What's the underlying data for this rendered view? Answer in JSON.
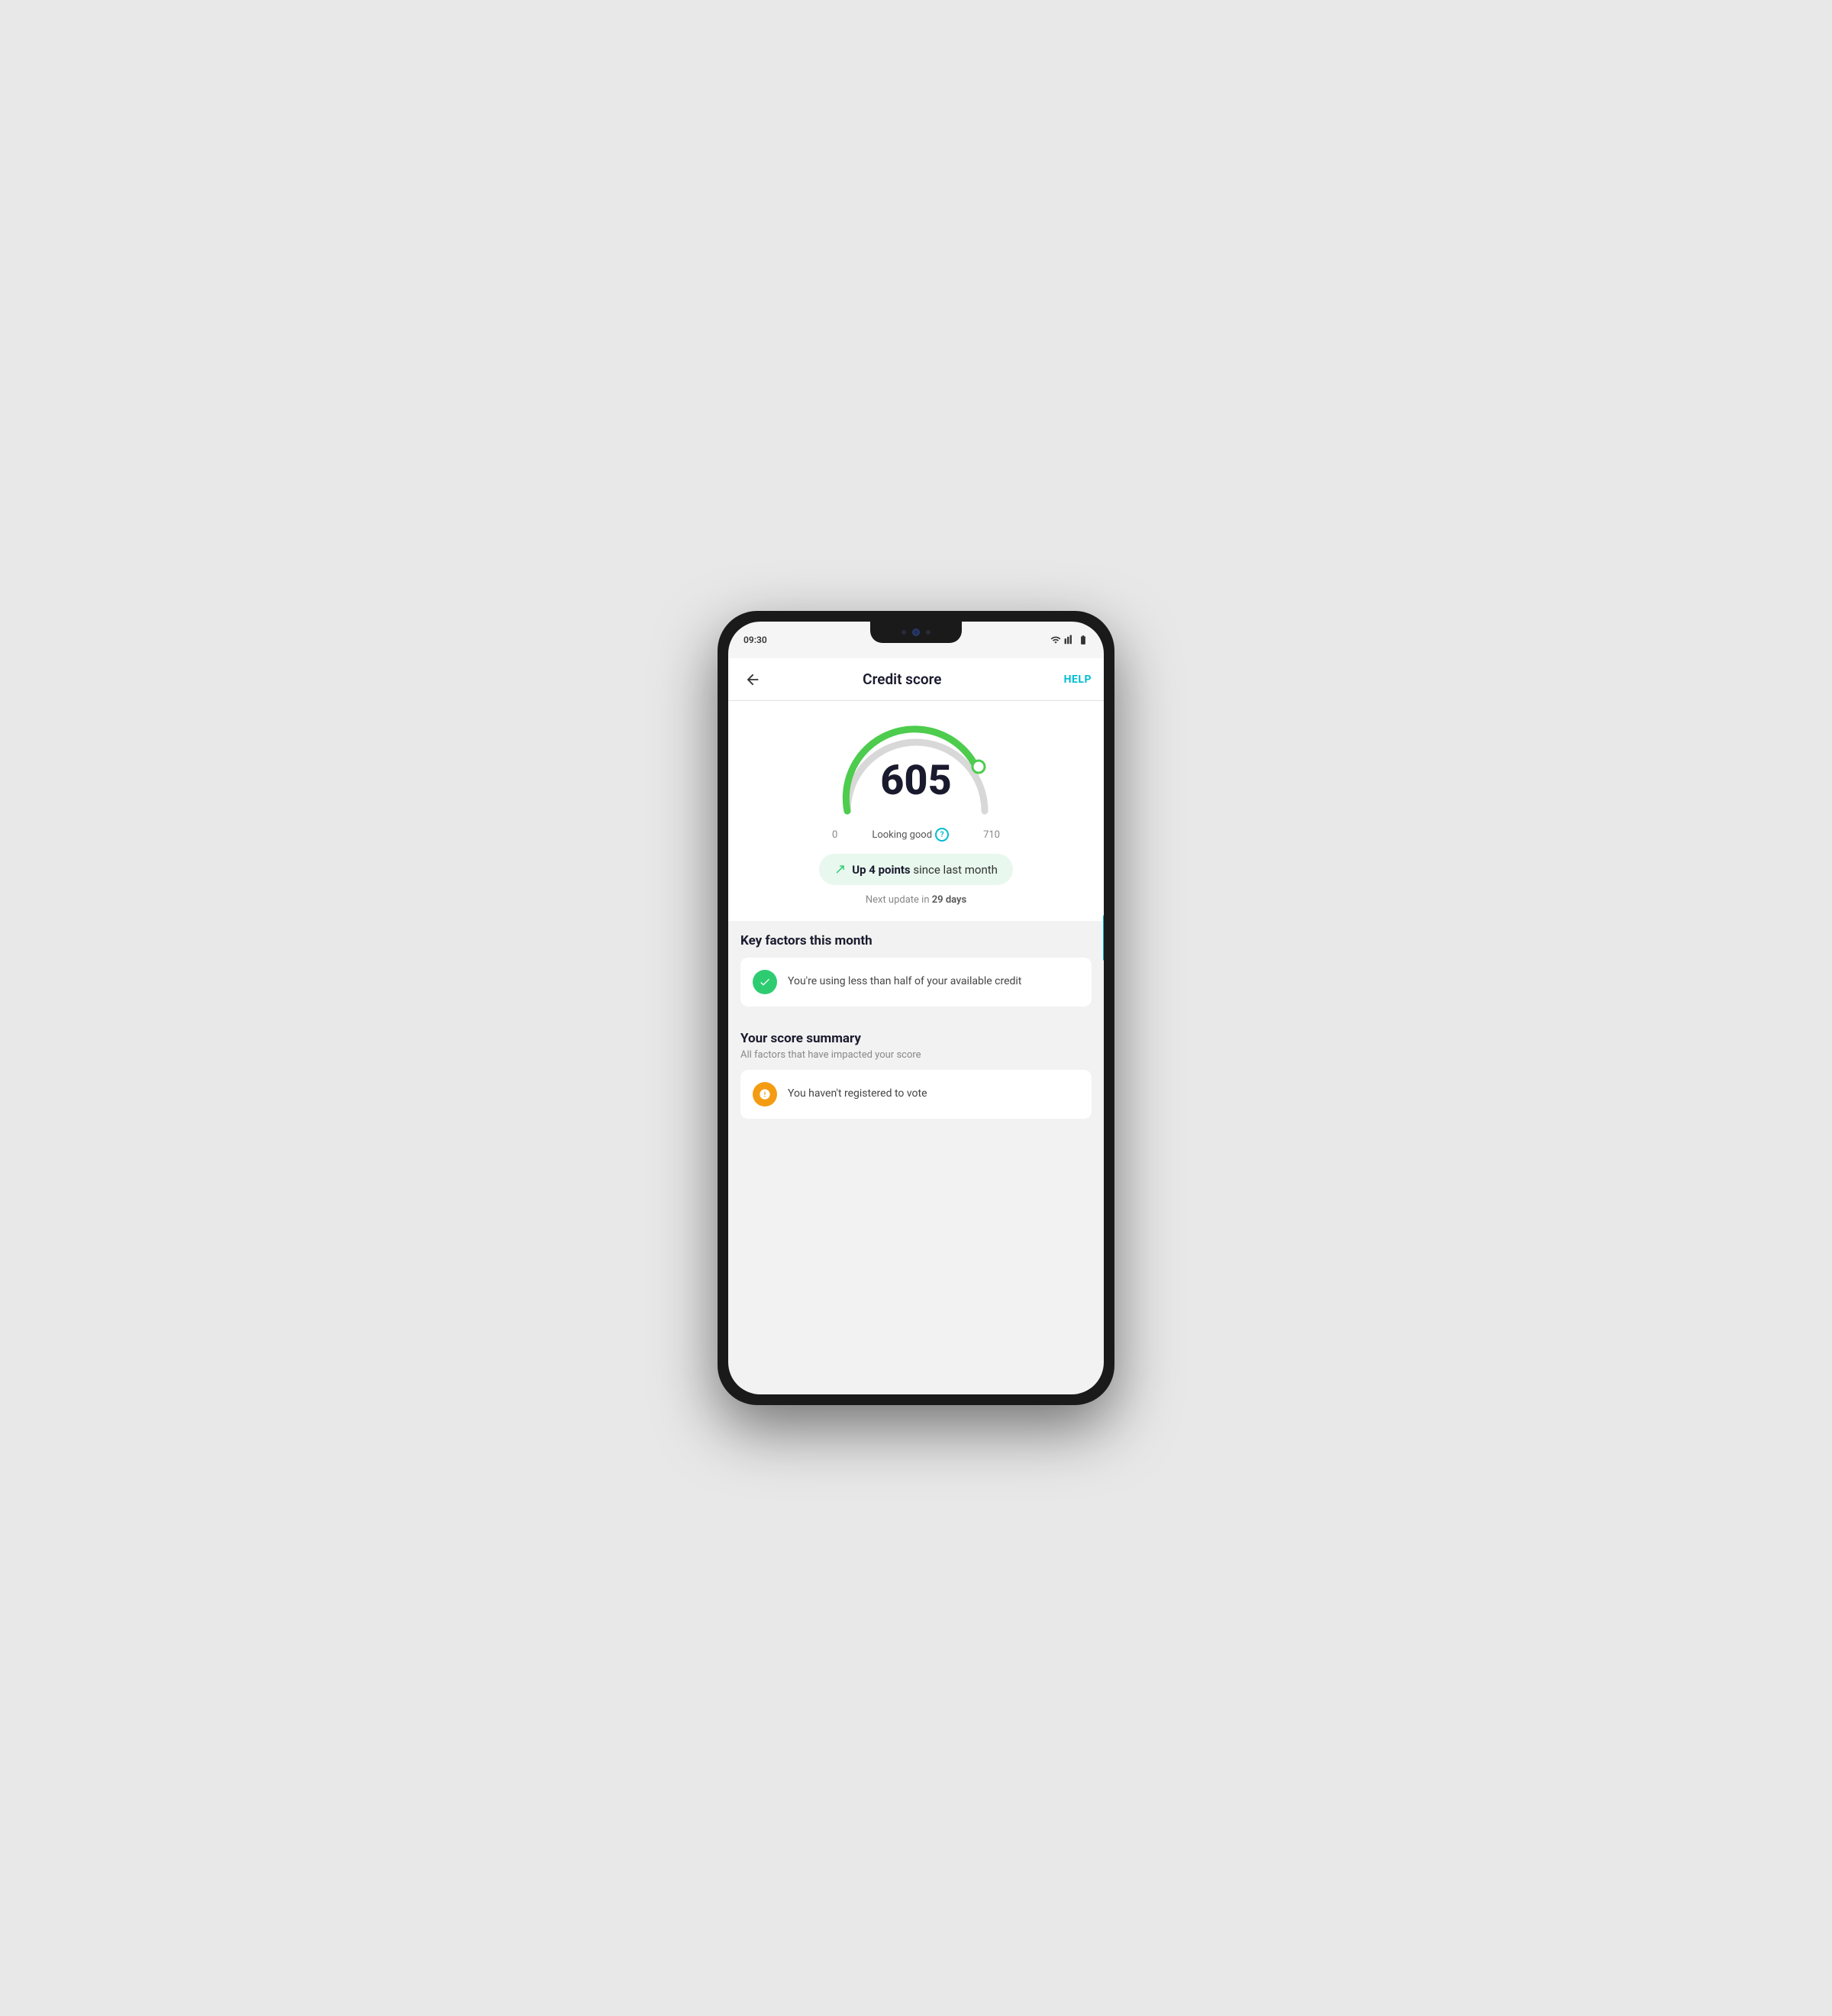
{
  "status_bar": {
    "time": "09:30",
    "icons": [
      "wifi",
      "signal",
      "battery"
    ]
  },
  "app_bar": {
    "back_label": "←",
    "title": "Credit score",
    "help_label": "HELP"
  },
  "score": {
    "value": "605",
    "min": "0",
    "max": "710",
    "status": "Looking good"
  },
  "up_badge": {
    "text_bold": "Up 4 points",
    "text_regular": " since last month"
  },
  "next_update": {
    "label": "Next update in ",
    "days": "29 days"
  },
  "key_factors": {
    "title": "Key factors this month",
    "items": [
      {
        "id": 1,
        "icon": "check",
        "icon_type": "green",
        "text": "You're using less than half of your available credit"
      }
    ]
  },
  "score_summary": {
    "title": "Your score summary",
    "subtitle": "All factors that have impacted your score",
    "items": [
      {
        "id": 1,
        "icon": "exclamation",
        "icon_type": "orange",
        "text": "You haven't registered to vote"
      }
    ]
  }
}
